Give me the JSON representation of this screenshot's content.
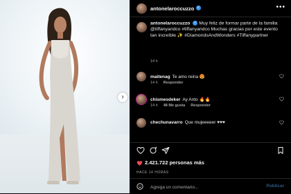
{
  "post": {
    "author": "antonelaroccuzzo",
    "caption": {
      "text": "Muy feliz de formar parte de la familia @tiffanyandco #tiffanyandco Muchas gracias por este evento tan increíble ✨ #DiamondsAndWonders #Tiffanypartner",
      "time": "14 h"
    },
    "comments": [
      {
        "user": "maitenag",
        "text": "Te amo reina 😍",
        "time": "14 h",
        "likes": "",
        "reply": "Responder"
      },
      {
        "user": "chismesdeker",
        "text": "Ay Anto 🔥🔥",
        "time": "14 h",
        "likes": "48 Me gusta",
        "reply": "Responder"
      },
      {
        "user": "chechunavarro",
        "text": "Que mujeeeeer ♥♥♥",
        "time": "",
        "likes": "",
        "reply": ""
      }
    ],
    "likes": "2.421.722 personas más",
    "posted": "HACE 14 HORAS"
  },
  "input": {
    "placeholder": "Agrega un comentario...",
    "post_label": "Publicar"
  },
  "colors": {
    "background": "#000000",
    "verified": "#3897f0",
    "liked_heart": "#ed4956",
    "muted_text": "#a8a8a8"
  }
}
